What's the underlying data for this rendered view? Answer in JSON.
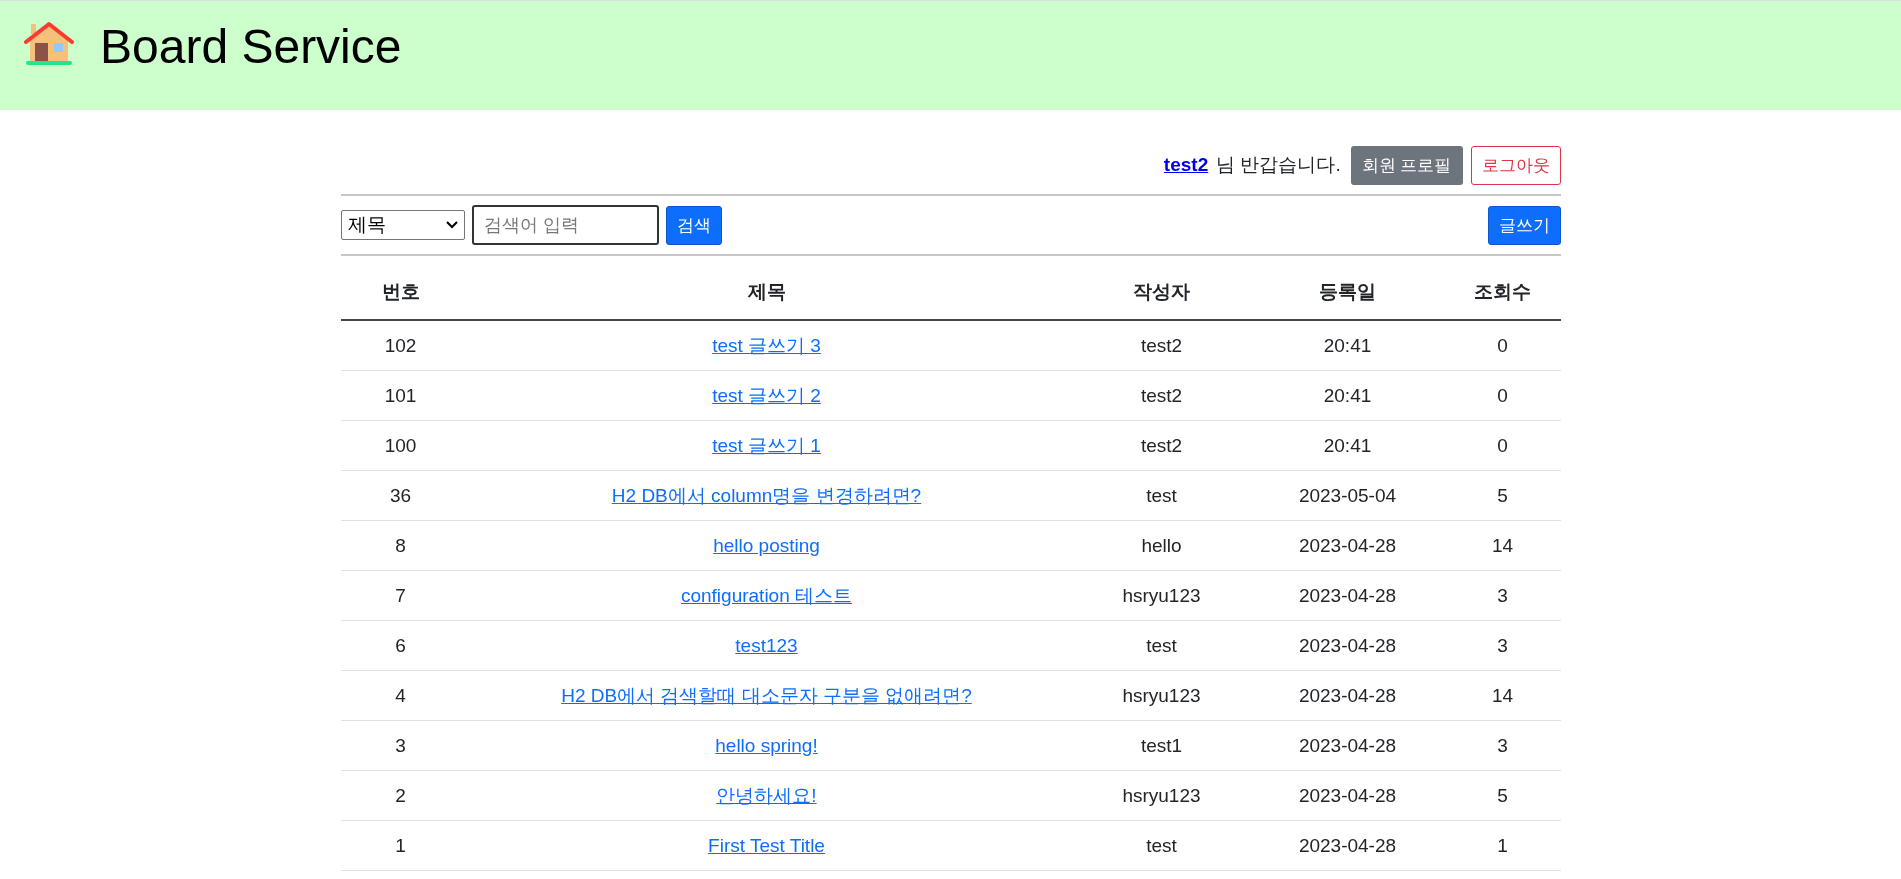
{
  "header": {
    "title": "Board Service"
  },
  "user_bar": {
    "username": "test2",
    "greeting": "님 반갑습니다.",
    "buttons": [
      {
        "label": "회원 프로필",
        "kind": "secondary"
      },
      {
        "label": "로그아웃",
        "kind": "outline-danger"
      }
    ]
  },
  "search": {
    "select_value": "제목",
    "placeholder": "검색어 입력",
    "button": "검색",
    "write_button": "글쓰기"
  },
  "table": {
    "columns": [
      "번호",
      "제목",
      "작성자",
      "등록일",
      "조회수"
    ],
    "rows": [
      {
        "number": "102",
        "title": "test 글쓰기 3",
        "author": "test2",
        "date": "20:41",
        "views": "0"
      },
      {
        "number": "101",
        "title": "test 글쓰기 2",
        "author": "test2",
        "date": "20:41",
        "views": "0"
      },
      {
        "number": "100",
        "title": "test 글쓰기 1",
        "author": "test2",
        "date": "20:41",
        "views": "0"
      },
      {
        "number": "36",
        "title": "H2 DB에서 column명을 변경하려면?",
        "author": "test",
        "date": "2023-05-04",
        "views": "5"
      },
      {
        "number": "8",
        "title": "hello posting",
        "author": "hello",
        "date": "2023-04-28",
        "views": "14"
      },
      {
        "number": "7",
        "title": "configuration 테스트",
        "author": "hsryu123",
        "date": "2023-04-28",
        "views": "3"
      },
      {
        "number": "6",
        "title": "test123",
        "author": "test",
        "date": "2023-04-28",
        "views": "3"
      },
      {
        "number": "4",
        "title": "H2 DB에서 검색할때 대소문자 구분을 없애려면?",
        "author": "hsryu123",
        "date": "2023-04-28",
        "views": "14"
      },
      {
        "number": "3",
        "title": "hello spring!",
        "author": "test1",
        "date": "2023-04-28",
        "views": "3"
      },
      {
        "number": "2",
        "title": "안녕하세요!",
        "author": "hsryu123",
        "date": "2023-04-28",
        "views": "5"
      },
      {
        "number": "1",
        "title": "First Test Title",
        "author": "test",
        "date": "2023-04-28",
        "views": "1"
      }
    ]
  }
}
